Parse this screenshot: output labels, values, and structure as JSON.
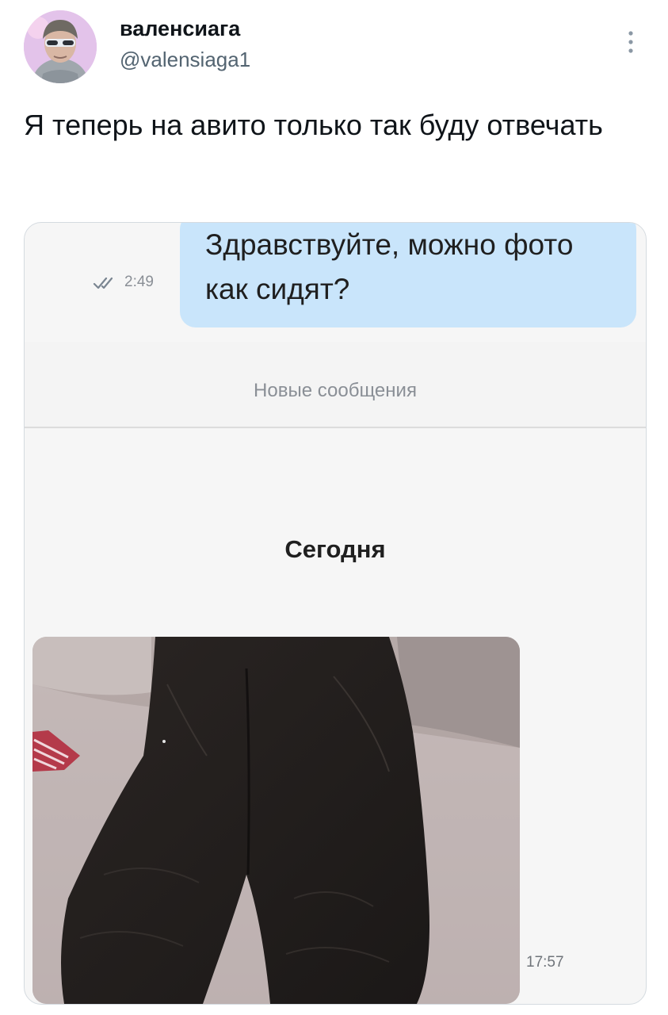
{
  "tweet": {
    "author_name": "валенсиага",
    "author_handle": "@valensiaga1",
    "text": "Я теперь на авито только так буду отвечать",
    "avatar_icon": "user-avatar",
    "more_icon": "more-vertical-icon"
  },
  "chat": {
    "sent_message": {
      "text": "Здравствуйте, можно фото как сидят?",
      "time": "2:49",
      "status_icon": "double-check-icon",
      "bubble_color": "#c9e5fb"
    },
    "new_messages_label": "Новые сообщения",
    "date_label": "Сегодня",
    "received_photo": {
      "icon": "photo-of-pants",
      "time": "17:57"
    }
  }
}
